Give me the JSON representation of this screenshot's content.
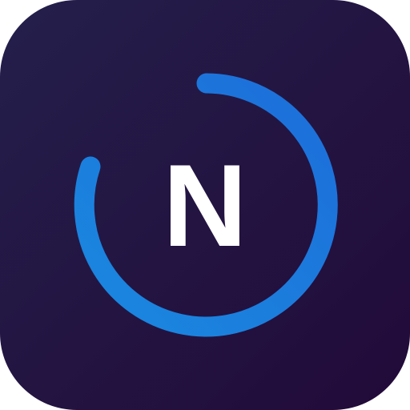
{
  "app_icon": {
    "letter": "N",
    "icon_name": "app-icon-n-with-progress-ring",
    "colors": {
      "background_start": "#241f4b",
      "background_end": "#220a39",
      "ring_start": "#1d6ed9",
      "ring_end": "#1a88df",
      "letter": "#ffffff"
    },
    "ring_progress": 0.8
  }
}
